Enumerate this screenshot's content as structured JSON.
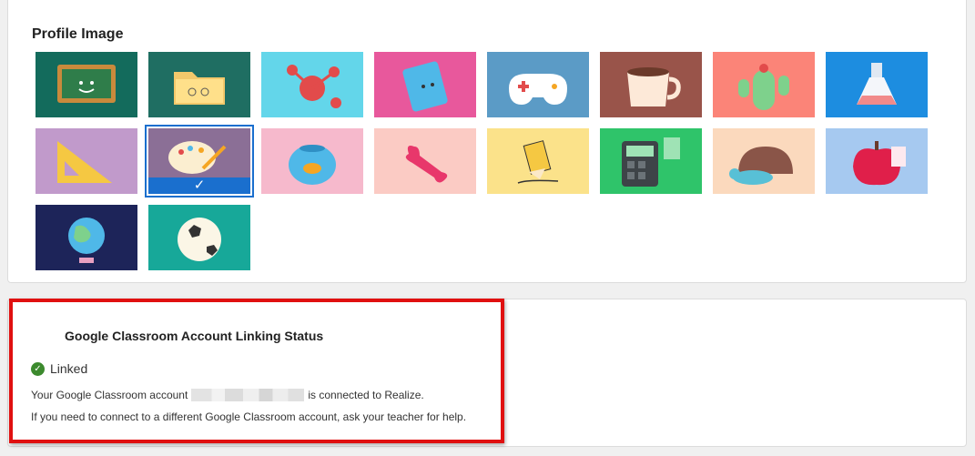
{
  "profile": {
    "title": "Profile Image",
    "tiles": [
      {
        "name": "chalkboard",
        "bg": "#136b5c"
      },
      {
        "name": "folder",
        "bg": "#1f6e62"
      },
      {
        "name": "molecule",
        "bg": "#63d6ea"
      },
      {
        "name": "notebook",
        "bg": "#e8589c"
      },
      {
        "name": "gamepad",
        "bg": "#5b9bc6"
      },
      {
        "name": "coffee-cup",
        "bg": "#99544a"
      },
      {
        "name": "cactus",
        "bg": "#fb8478"
      },
      {
        "name": "flask",
        "bg": "#1d8de0"
      },
      {
        "name": "triangle-ruler",
        "bg": "#c19acb"
      },
      {
        "name": "paint-palette",
        "bg": "#8b6f96",
        "selected": true
      },
      {
        "name": "fishbowl",
        "bg": "#f6b9cc"
      },
      {
        "name": "bone",
        "bg": "#fbcbc4"
      },
      {
        "name": "pencil",
        "bg": "#fbe28a"
      },
      {
        "name": "calculator",
        "bg": "#2fc46a"
      },
      {
        "name": "turtle",
        "bg": "#fbd9bd"
      },
      {
        "name": "apple",
        "bg": "#a6c9f0"
      },
      {
        "name": "globe",
        "bg": "#1d2459"
      },
      {
        "name": "soccer-ball",
        "bg": "#17a899"
      }
    ],
    "selected_mark": "✓"
  },
  "linking": {
    "title": "Google Classroom Account Linking Status",
    "status": "Linked",
    "status_icon": "check-circle-icon",
    "message_before": "Your Google Classroom account",
    "message_after": "is connected to Realize.",
    "help": "If you need to connect to a different Google Classroom account, ask your teacher for help."
  },
  "colors": {
    "accent": "#1a6fce",
    "success": "#3c8a2e",
    "highlight": "#e01010"
  }
}
